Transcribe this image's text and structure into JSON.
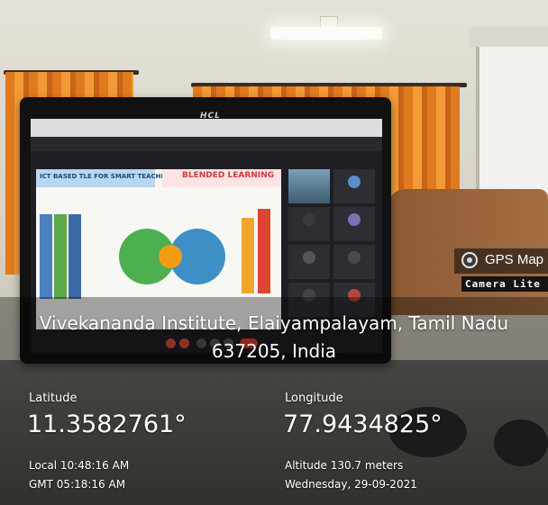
{
  "badge": {
    "title": "GPS Map",
    "subtitle": "Camera Lite",
    "icon": "camera-lens-icon"
  },
  "address": "Vivekananda Institute, Elaiyampalayam, Tamil Nadu 637205, India",
  "coords": {
    "latitude_label": "Latitude",
    "latitude_value": "11.3582761°",
    "longitude_label": "Longitude",
    "longitude_value": "77.9434825°"
  },
  "details": {
    "local_time": "Local 10:48:16 AM",
    "gmt_time": "GMT 05:18:16 AM",
    "altitude": "Altitude 130.7 meters",
    "date": "Wednesday, 29-09-2021"
  },
  "photo": {
    "monitor_brand": "HCL",
    "slide_left_title": "ICT BASED TLE FOR SMART TEACHING",
    "slide_right_title": "BLENDED LEARNING"
  },
  "colors": {
    "curtain": "#e8862a",
    "text": "#ffffff",
    "slide_title_red": "#d33a3a"
  }
}
